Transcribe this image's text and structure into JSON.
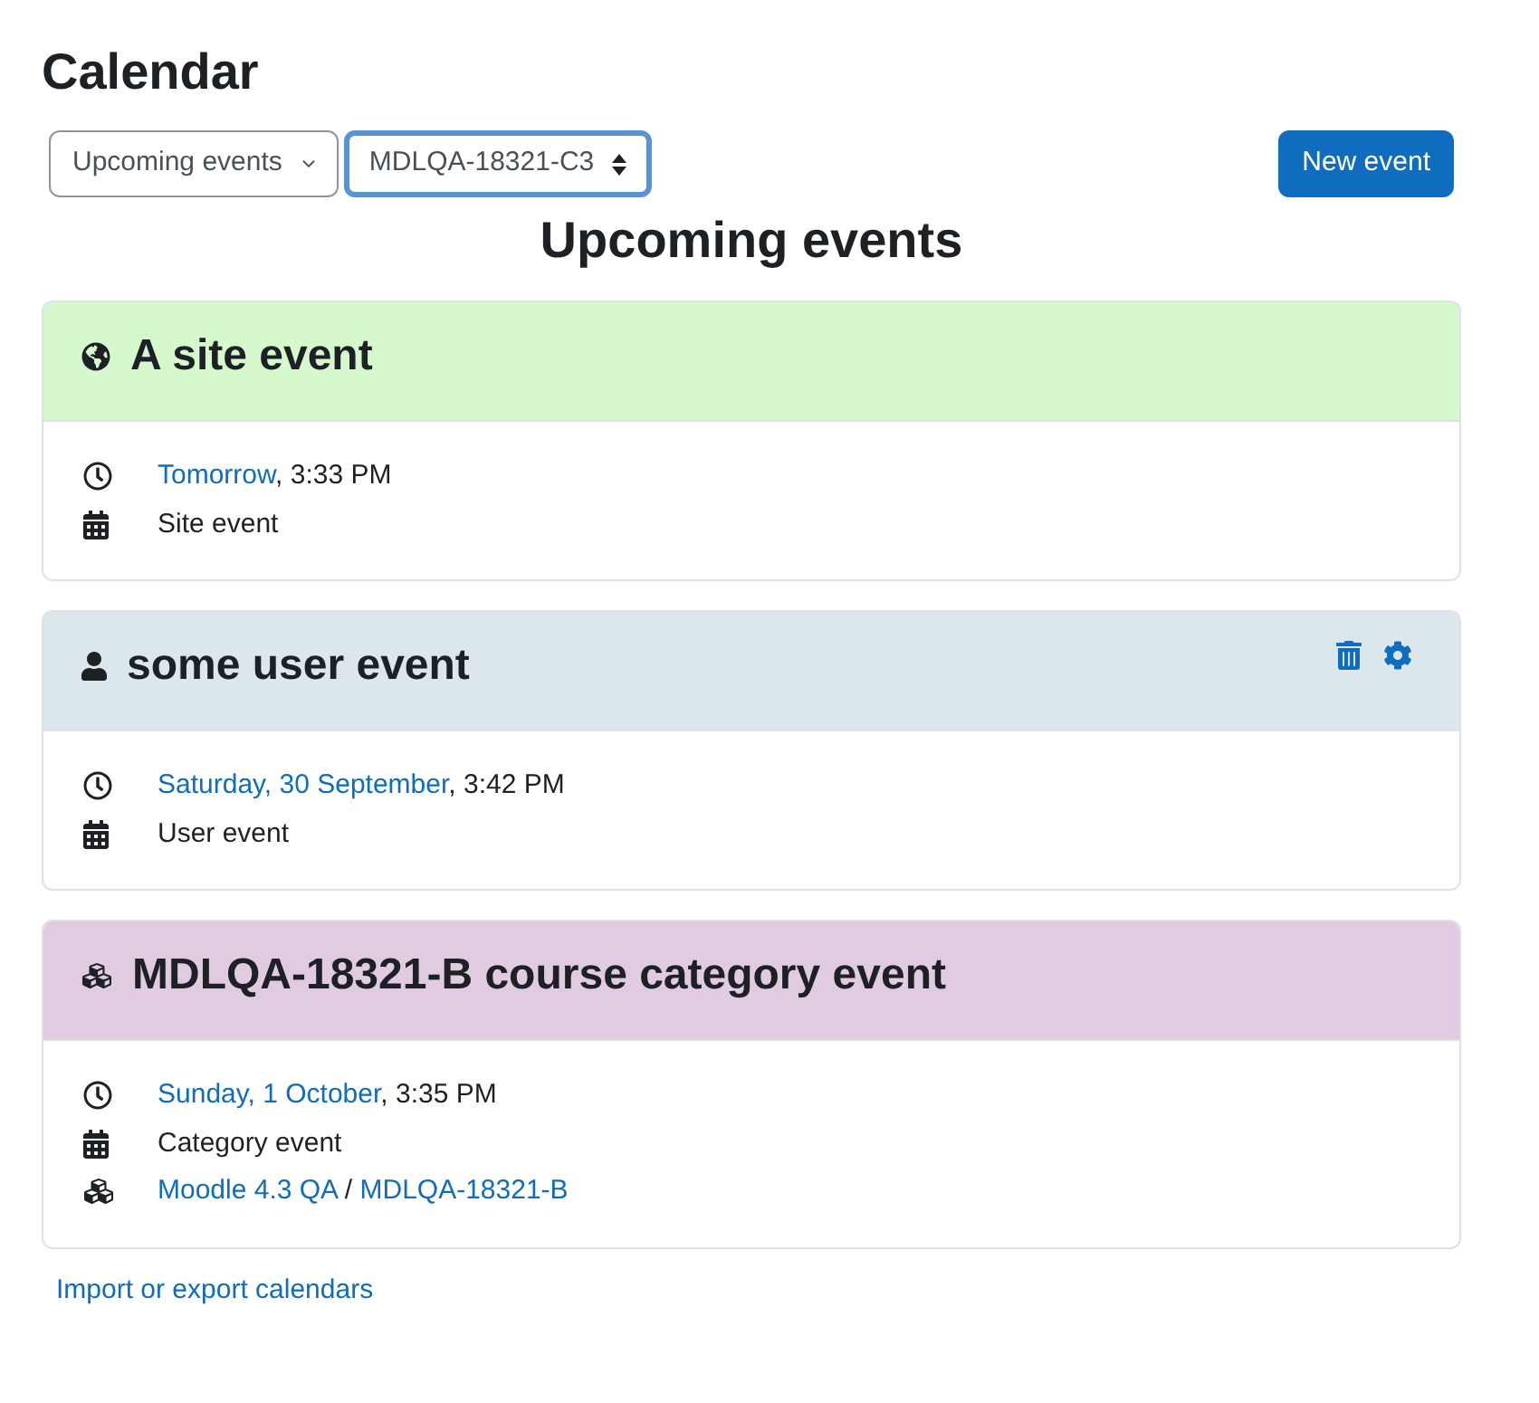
{
  "page": {
    "title": "Calendar"
  },
  "toolbar": {
    "view_select": {
      "value": "Upcoming events",
      "focused": false
    },
    "course_select": {
      "value": "MDLQA-18321-C3",
      "focused": true
    },
    "new_event_button": "New event"
  },
  "heading": "Upcoming events",
  "events": [
    {
      "kind": "site",
      "title": "A site event",
      "color": "#d6f8cd",
      "editable": false,
      "details": [
        {
          "kind": "when",
          "link": "Tomorrow",
          "rest": ", 3:33 PM"
        },
        {
          "kind": "type",
          "text": "Site event"
        }
      ]
    },
    {
      "kind": "user",
      "title": "some user event",
      "color": "#dce7ec",
      "editable": true,
      "details": [
        {
          "kind": "when",
          "link": "Saturday, 30 September",
          "rest": ", 3:42 PM"
        },
        {
          "kind": "type",
          "text": "User event"
        }
      ]
    },
    {
      "kind": "category",
      "title": "MDLQA-18321-B course category event",
      "color": "#e0cbe0",
      "editable": false,
      "details": [
        {
          "kind": "when",
          "link": "Sunday, 1 October",
          "rest": ", 3:35 PM"
        },
        {
          "kind": "type",
          "text": "Category event"
        },
        {
          "kind": "location",
          "links": [
            "Moodle 4.3 QA",
            "MDLQA-18321-B"
          ],
          "separator": "/"
        }
      ]
    }
  ],
  "footer_link": "Import or export calendars"
}
